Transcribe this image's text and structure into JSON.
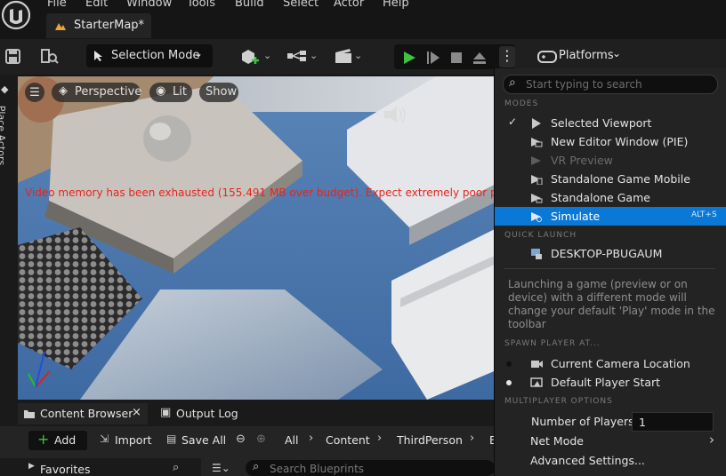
{
  "menubar": {
    "items": [
      "File",
      "Edit",
      "Window",
      "Tools",
      "Build",
      "Select",
      "Actor",
      "Help"
    ]
  },
  "tab": {
    "title": "StarterMap*"
  },
  "toolbar": {
    "selection_mode": "Selection Mode",
    "platforms": "Platforms"
  },
  "viewport": {
    "perspective": "Perspective",
    "lit": "Lit",
    "show": "Show",
    "warning": "Video memory has been exhausted (155.491 MB over budget). Expect extremely poor perf"
  },
  "side_panel": {
    "label": "Place Actors"
  },
  "bottom": {
    "tab_content_browser": "Content Browser",
    "tab_output_log": "Output Log",
    "add": "Add",
    "import": "Import",
    "save_all": "Save All",
    "breadcrumbs": [
      "All",
      "Content",
      "ThirdPerson",
      "E"
    ],
    "favorites": "Favorites",
    "search_placeholder": "Search Blueprints"
  },
  "dropdown": {
    "search_placeholder": "Start typing to search",
    "modes_header": "MODES",
    "modes": [
      {
        "label": "Selected Viewport",
        "checked": true
      },
      {
        "label": "New Editor Window (PIE)"
      },
      {
        "label": "VR Preview",
        "disabled": true
      },
      {
        "label": "Standalone Game Mobile"
      },
      {
        "label": "Standalone Game"
      },
      {
        "label": "Simulate",
        "shortcut": "ALT+S",
        "highlighted": true
      }
    ],
    "quick_launch_header": "QUICK LAUNCH",
    "device": "DESKTOP-PBUGAUM",
    "info": "Launching a game (preview or on device) with a different mode will change your default 'Play' mode in the toolbar",
    "spawn_header": "SPAWN PLAYER AT...",
    "spawn": [
      {
        "label": "Current Camera Location",
        "selected": false
      },
      {
        "label": "Default Player Start",
        "selected": true
      }
    ],
    "multiplayer_header": "MULTIPLAYER OPTIONS",
    "num_players_label": "Number of Players",
    "num_players_value": "1",
    "net_mode": "Net Mode",
    "advanced": "Advanced Settings..."
  },
  "colors": {
    "accent": "#0a78d7",
    "play_green": "#3ec23e",
    "warning_red": "#e8231d"
  }
}
